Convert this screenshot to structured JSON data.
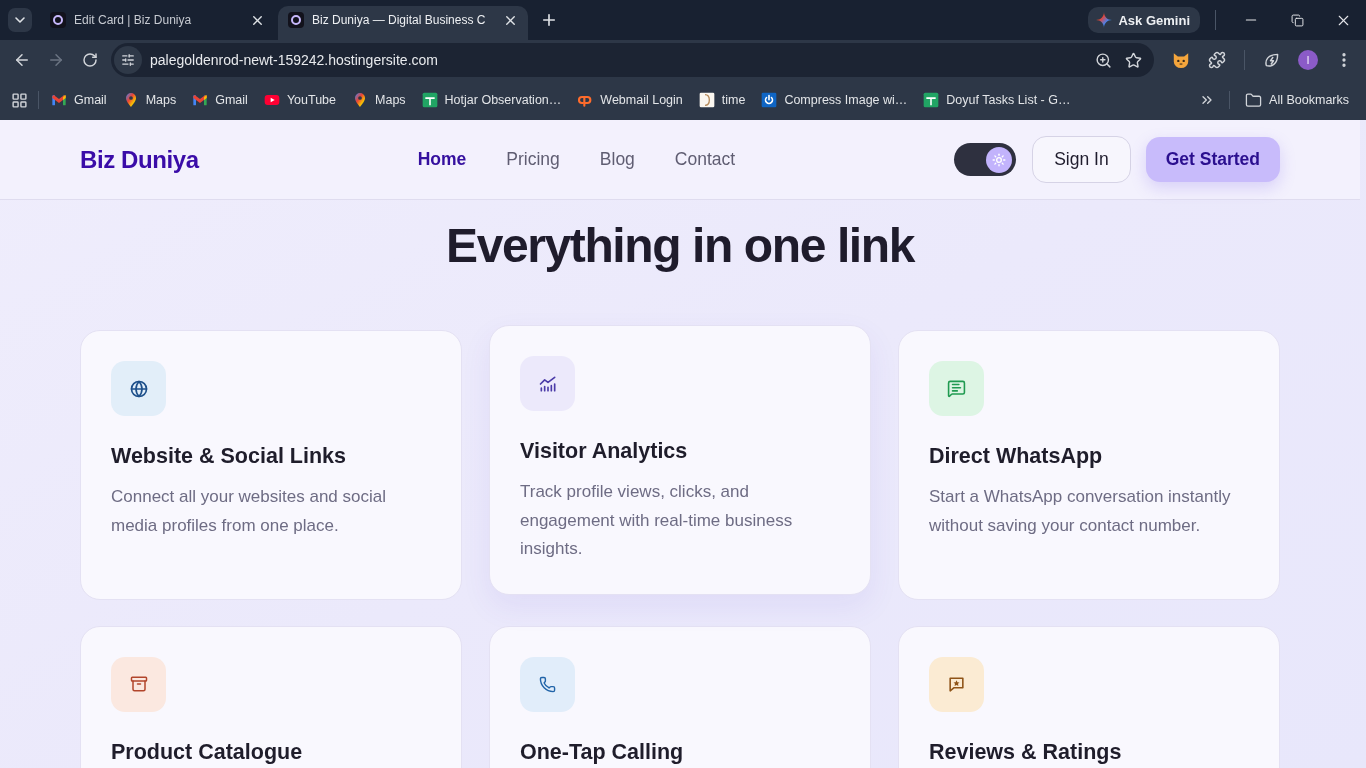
{
  "browser": {
    "tabs": [
      {
        "title": "Edit Card | Biz Duniya",
        "selected": false
      },
      {
        "title": "Biz Duniya — Digital Business C",
        "selected": true
      }
    ],
    "gemini_button": "Ask Gemini",
    "back": {
      "disabled": false
    },
    "forward": {
      "disabled": true
    },
    "address": "palegoldenrod-newt-159242.hostingersite.com",
    "profile_initial": "I",
    "bookmarks": [
      {
        "label": "Gmail"
      },
      {
        "label": "Maps"
      },
      {
        "label": "Gmail"
      },
      {
        "label": "YouTube"
      },
      {
        "label": "Maps"
      },
      {
        "label": "Hotjar Observation…"
      },
      {
        "label": "Webmail Login"
      },
      {
        "label": "time"
      },
      {
        "label": "Compress Image wi…"
      },
      {
        "label": "Doyuf Tasks List - G…"
      }
    ],
    "all_bookmarks": "All Bookmarks"
  },
  "page": {
    "logo": "Biz Duniya",
    "nav": [
      {
        "label": "Home",
        "selected": true
      },
      {
        "label": "Pricing",
        "selected": false
      },
      {
        "label": "Blog",
        "selected": false
      },
      {
        "label": "Contact",
        "selected": false
      }
    ],
    "theme_toggle": {
      "on": true
    },
    "sign_in": "Sign In",
    "get_started": "Get Started",
    "heading": "Everything in one link",
    "features": [
      {
        "title": "Website & Social Links",
        "description": "Connect all your websites and social media profiles from one place.",
        "hovered": false
      },
      {
        "title": "Visitor Analytics",
        "description": "Track profile views, clicks, and engagement with real-time business insights.",
        "hovered": true
      },
      {
        "title": "Direct WhatsApp",
        "description": "Start a WhatsApp conversation instantly without saving your contact number.",
        "hovered": false
      },
      {
        "title": "Product Catalogue",
        "hovered": false
      },
      {
        "title": "One-Tap Calling",
        "hovered": false
      },
      {
        "title": "Reviews & Ratings",
        "hovered": false
      }
    ]
  }
}
